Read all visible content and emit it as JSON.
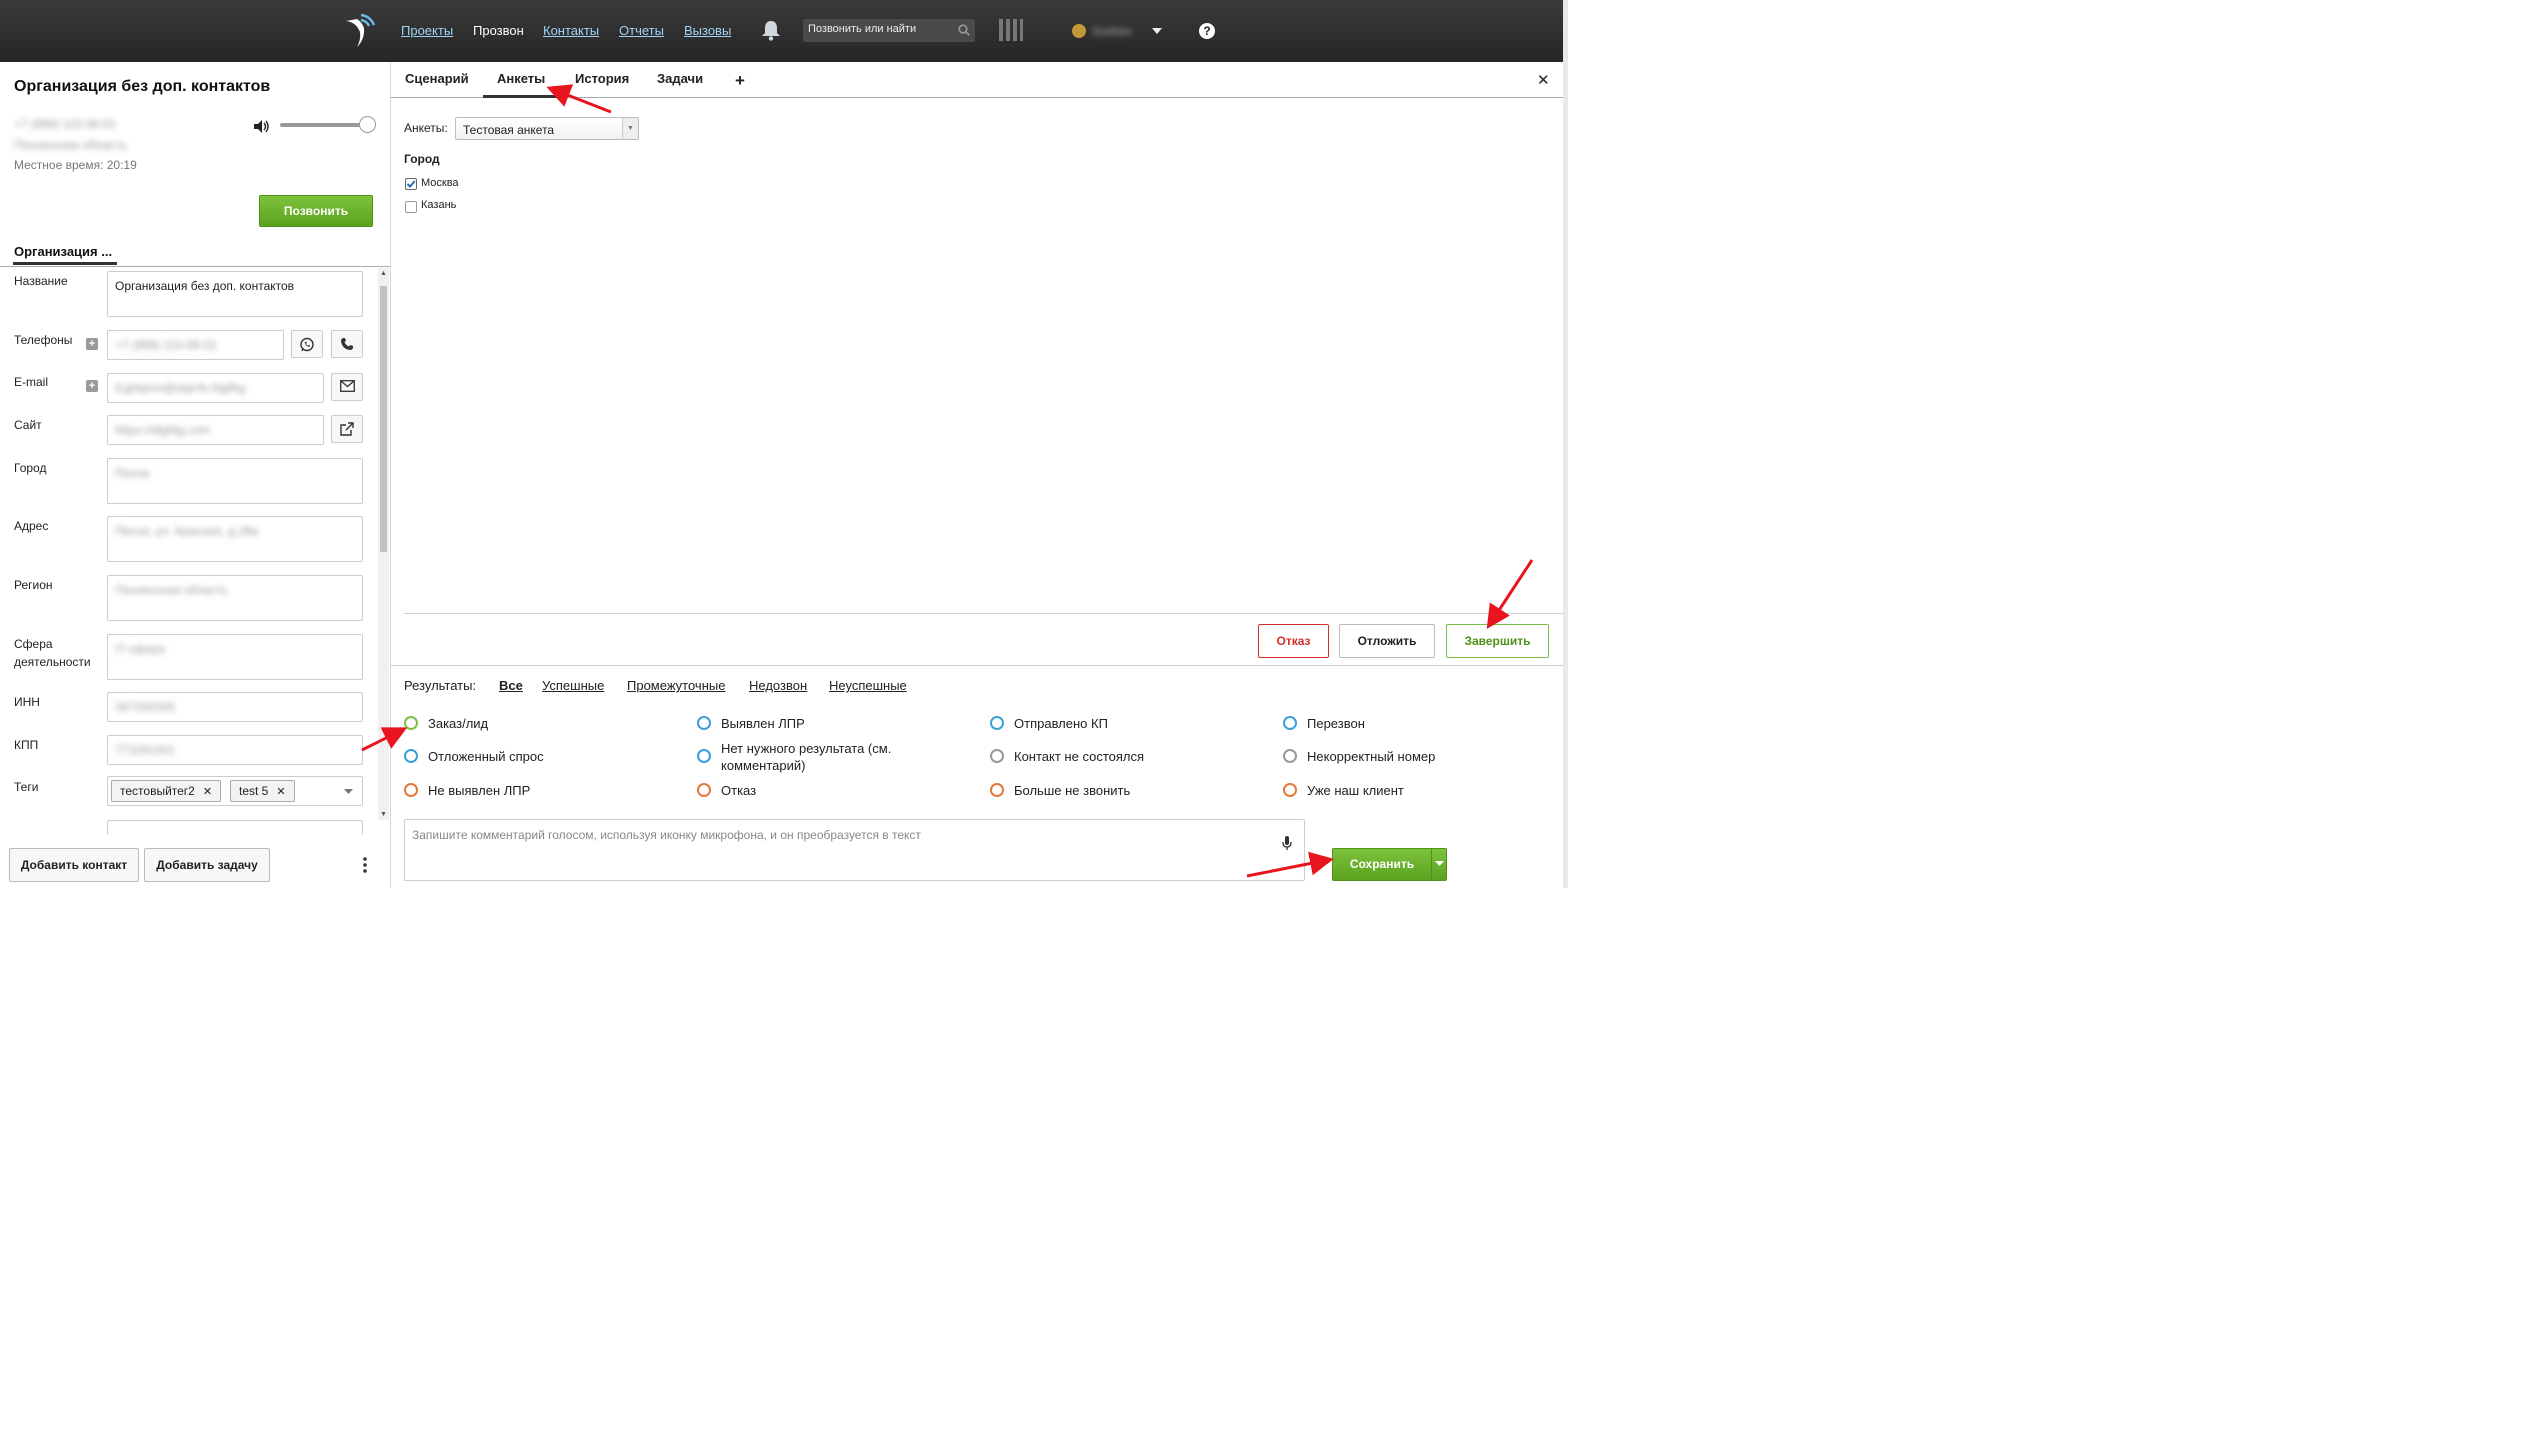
{
  "app": {
    "logo": "callbox-logo-icon"
  },
  "nav": {
    "items": [
      "Проекты",
      "Прозвон",
      "Контакты",
      "Отчеты",
      "Вызовы"
    ],
    "active": "Прозвон"
  },
  "search": {
    "placeholder": "Позвонить или найти"
  },
  "user": {
    "name": "Sovbes"
  },
  "contact": {
    "title": "Организация без доп. контактов",
    "phone": "+7 (999) 110-08-01",
    "region": "Пензенская область",
    "local_time": "Местное время: 20:19",
    "call_label": "Позвонить",
    "org_tab": "Организация ..."
  },
  "fields": {
    "name_label": "Название",
    "name_value": "Организация без доп. контактов",
    "phones_label": "Телефоны",
    "phone_value": "+7 (999) 110-08-01",
    "email_label": "E-mail",
    "email_value": "fcghkjnm@dsjrrfe.fdgfhg",
    "site_label": "Сайт",
    "site_value": "https://dfgfdg.com",
    "city_label": "Город",
    "city_value": "Пенза",
    "address_label": "Адрес",
    "address_value": "Пенза, ул. Красная, д.28а",
    "region_label": "Регион",
    "region_value": "Пензенская область",
    "sphere_label": "Сфера деятельности",
    "sphere_value": "IT-сфера",
    "inn_label": "ИНН",
    "inn_value": "347345345",
    "kpp_label": "КПП",
    "kpp_value": "773261001",
    "tags_label": "Теги",
    "tags": [
      "тестовыйтег2",
      "test 5"
    ]
  },
  "bottom": {
    "add_contact": "Добавить контакт",
    "add_task": "Добавить задачу"
  },
  "tabs": {
    "items": [
      "Сценарий",
      "Анкеты",
      "История",
      "Задачи"
    ],
    "active": "Анкеты"
  },
  "survey": {
    "label": "Анкеты:",
    "selected": "Тестовая анкета",
    "question": "Город",
    "options": [
      {
        "label": "Москва",
        "checked": true
      },
      {
        "label": "Казань",
        "checked": false
      }
    ]
  },
  "actions": {
    "refuse": "Отказ",
    "postpone": "Отложить",
    "finish": "Завершить"
  },
  "results": {
    "label": "Результаты:",
    "filters": [
      "Все",
      "Успешные",
      "Промежуточные",
      "Недозвон",
      "Неуспешные"
    ],
    "active_filter": "Все",
    "items": [
      {
        "label": "Заказ/лид",
        "color": "#7cc043"
      },
      {
        "label": "Выявлен ЛПР",
        "color": "#3aa0d8"
      },
      {
        "label": "Отправлено КП",
        "color": "#3aa0d8"
      },
      {
        "label": "Перезвон",
        "color": "#3aa0d8"
      },
      {
        "label": "Отложенный спрос",
        "color": "#3aa0d8"
      },
      {
        "label": "Нет нужного результата (см.",
        "label2": "комментарий)",
        "color": "#3aa0d8"
      },
      {
        "label": "Контакт не состоялся",
        "color": "#999999"
      },
      {
        "label": "Некорректный номер",
        "color": "#999999"
      },
      {
        "label": "Не выявлен ЛПР",
        "color": "#e07a3a"
      },
      {
        "label": "Отказ",
        "color": "#e07a3a"
      },
      {
        "label": "Больше не звонить",
        "color": "#e07a3a"
      },
      {
        "label": "Уже наш клиент",
        "color": "#e07a3a"
      }
    ]
  },
  "comment": {
    "placeholder": "Запишите комментарий голосом, используя иконку микрофона, и он преобразуется в текст"
  },
  "save": {
    "label": "Сохранить"
  },
  "colors": {
    "brand_green": "#6ab42d",
    "refuse_red": "#d32f2f",
    "link_blue": "#9fd3f5",
    "annotation_red": "#e8141e"
  }
}
